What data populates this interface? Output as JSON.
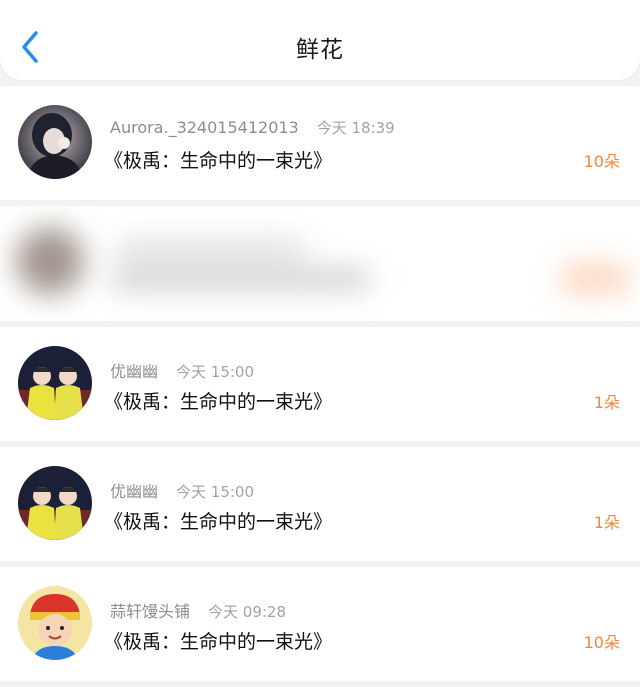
{
  "header": {
    "title": "鲜花",
    "back_icon": "chevron-left-icon",
    "accent": "#2a8cf0"
  },
  "count_color": "#f3863a",
  "records": [
    {
      "user": "Aurora._324015412013",
      "time": "今天 18:39",
      "work": "《极禹：生命中的一束光》",
      "count": "10朵",
      "avatar_icon": "portrait-avatar"
    },
    {
      "user": "优幽幽",
      "time": "今天 15:00",
      "work": "《极禹：生命中的一束光》",
      "count": "1朵",
      "avatar_icon": "two-person-avatar"
    },
    {
      "user": "优幽幽",
      "time": "今天 15:00",
      "work": "《极禹：生命中的一束光》",
      "count": "1朵",
      "avatar_icon": "two-person-avatar"
    },
    {
      "user": "蒜轩馒头铺",
      "time": "今天 09:28",
      "work": "《极禹：生命中的一束光》",
      "count": "10朵",
      "avatar_icon": "cartoon-avatar"
    }
  ]
}
